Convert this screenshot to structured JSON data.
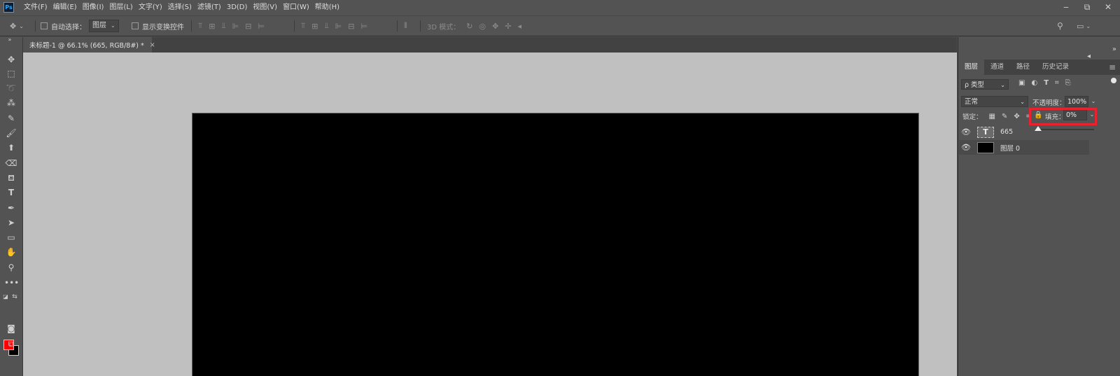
{
  "app": {
    "logo": "Ps"
  },
  "menu": [
    "文件(F)",
    "编辑(E)",
    "图像(I)",
    "图层(L)",
    "文字(Y)",
    "选择(S)",
    "滤镜(T)",
    "3D(D)",
    "视图(V)",
    "窗口(W)",
    "帮助(H)"
  ],
  "window_controls": {
    "minimize": "‒",
    "restore": "⧉",
    "close": "✕"
  },
  "options": {
    "auto_select_label": "自动选择：",
    "auto_select_value": "图层",
    "show_transform_label": "显示变换控件",
    "mode_3d_label": "3D 模式："
  },
  "document_tab": {
    "title": "未标题-1 @ 66.1% (665, RGB/8#) *",
    "close": "×"
  },
  "layers_panel": {
    "tabs": [
      "图层",
      "通道",
      "路径",
      "历史记录"
    ],
    "filter_value": "ρ 类型",
    "blend_mode": "正常",
    "opacity_label": "不透明度：",
    "opacity_value": "100%",
    "lock_label": "锁定：",
    "fill_label": "填充：",
    "fill_value": "0%",
    "fill_percent": 0,
    "layers": [
      {
        "name": "665",
        "thumb": "T",
        "kind": "text"
      },
      {
        "name": "图层 0",
        "thumb": "",
        "kind": "fill"
      }
    ]
  },
  "colors": {
    "foreground": "#ff0000",
    "background": "#000000",
    "canvas": "#000000",
    "highlight": "#e8222f"
  }
}
